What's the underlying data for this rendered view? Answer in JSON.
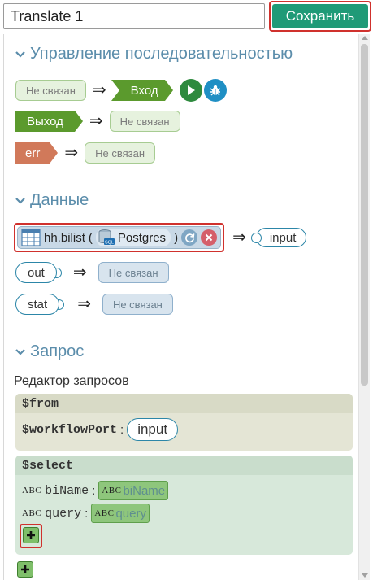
{
  "header": {
    "title_value": "Translate 1",
    "save_label": "Сохранить"
  },
  "control_flow": {
    "section_title": "Управление последовательностью",
    "unlinked": "Не связан",
    "input_label": "Вход",
    "output_label": "Выход",
    "error_label": "err",
    "arrow": "⇒"
  },
  "data": {
    "section_title": "Данные",
    "source_name": "hh.bilist",
    "paren_open": "(",
    "db_name": "Postgres",
    "paren_close": ")",
    "db_icon_text": "SQL",
    "input_port": "input",
    "out_port": "out",
    "stat_port": "stat",
    "unlinked": "Не связан",
    "arrow": "⇒"
  },
  "query": {
    "section_title": "Запрос",
    "editor_label": "Редактор запросов",
    "from_block": {
      "head": "$from",
      "key": "$workflowPort",
      "colon": ":",
      "value": "input"
    },
    "select_block": {
      "head": "$select",
      "fields": [
        {
          "type": "ABC",
          "name": "biName",
          "colon": ":",
          "alias_type": "ABC",
          "alias": "biName"
        },
        {
          "type": "ABC",
          "name": "query",
          "colon": ":",
          "alias_type": "ABC",
          "alias": "query"
        }
      ]
    }
  },
  "colors": {
    "accent": "#1f9a77",
    "section_title": "#5b8dab",
    "highlight_border": "#d0312d",
    "flow_green": "#5b9a2d",
    "error_orange": "#d1795a"
  },
  "icons": {
    "play": "play-icon",
    "debug": "bug-icon",
    "table": "table-icon",
    "database": "database-icon",
    "refresh": "refresh-icon",
    "remove": "close-icon",
    "chevron": "chevron-down-icon",
    "add": "plus-icon"
  }
}
